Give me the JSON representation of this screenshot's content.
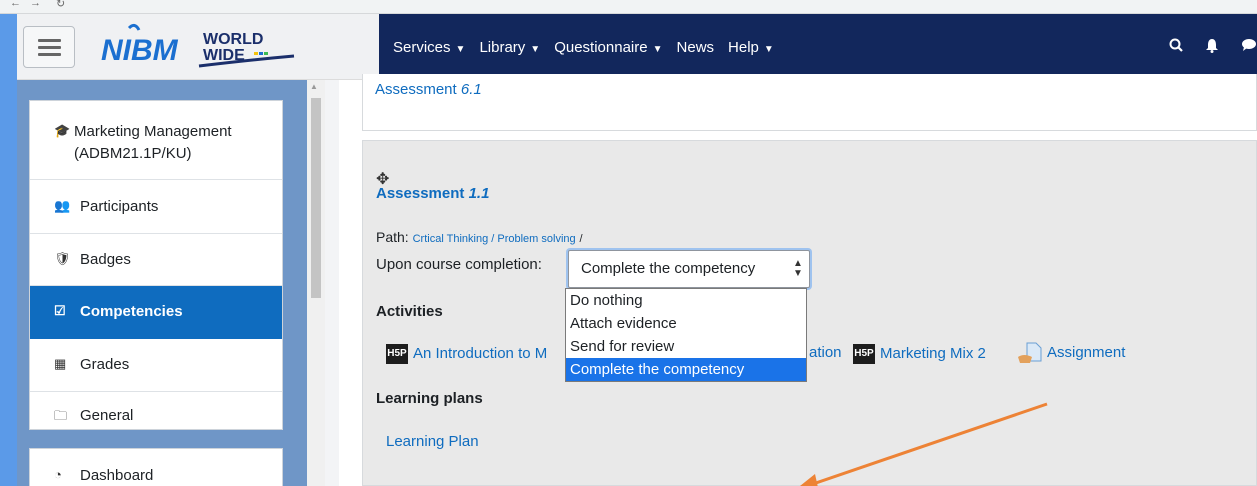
{
  "colors": {
    "navbar": "#12275c",
    "accent": "#0f6cbf",
    "sidebar_bg": "#6f96c7",
    "frame": "#5b9ae8",
    "arrow": "#ed8336"
  },
  "brand": {
    "logo_nibm": "NIBM",
    "logo_world": "WORLD",
    "logo_wide": "WIDE"
  },
  "navbar": {
    "menu": [
      {
        "label": "Services"
      },
      {
        "label": "Library"
      },
      {
        "label": "Questionnaire"
      },
      {
        "label": "News"
      },
      {
        "label": "Help"
      }
    ],
    "icons": [
      "search-icon",
      "bell-icon",
      "chat-icon"
    ]
  },
  "drawer": {
    "items": [
      {
        "label": "Marketing Management (ADBM21.1P/KU)",
        "icon": "graduation-cap-icon"
      },
      {
        "label": "Participants",
        "icon": "users-icon"
      },
      {
        "label": "Badges",
        "icon": "shield-icon"
      },
      {
        "label": "Competencies",
        "icon": "check-square-icon",
        "active": true
      },
      {
        "label": "Grades",
        "icon": "table-icon"
      },
      {
        "label": "General",
        "icon": "folder-icon"
      }
    ],
    "secondary": [
      {
        "label": "Dashboard",
        "icon": "dashboard-icon"
      }
    ]
  },
  "main": {
    "prev_assessment": {
      "link": "Assessment",
      "num": "6.1"
    },
    "competency": {
      "title": "Assessment",
      "title_num": "1.1",
      "path_label": "Path:",
      "path_link": "Crtical Thinking / Problem solving",
      "path_sep": "/",
      "completion_label": "Upon course completion:",
      "completion_selected": "Complete the competency",
      "completion_options": [
        "Do nothing",
        "Attach evidence",
        "Send for review",
        "Complete the competency"
      ],
      "activities_heading": "Activities",
      "activities": [
        {
          "label": "An Introduction to M",
          "type": "h5p"
        },
        {
          "label": "ation",
          "type": "h5p-cut"
        },
        {
          "label": "Marketing Mix 2",
          "type": "h5p"
        },
        {
          "label": "Assignment",
          "type": "assignment"
        }
      ],
      "learning_plans_heading": "Learning plans",
      "learning_plan": "Learning Plan"
    }
  }
}
